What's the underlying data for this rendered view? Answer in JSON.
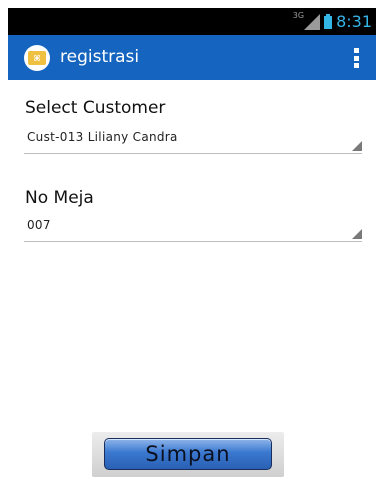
{
  "status_bar": {
    "network_type": "3G",
    "time": "8:31",
    "accent_color": "#33b5e5",
    "icons": [
      "signal-icon",
      "battery-icon"
    ]
  },
  "action_bar": {
    "title": "registrasi",
    "background": "#1565c0",
    "icons": [
      "app-logo-icon",
      "overflow-menu-icon"
    ]
  },
  "form": {
    "customer": {
      "label": "Select Customer",
      "value": "Cust-013 Liliany Candra"
    },
    "table": {
      "label": "No Meja",
      "value": "007"
    }
  },
  "actions": {
    "save_label": "Simpan"
  }
}
